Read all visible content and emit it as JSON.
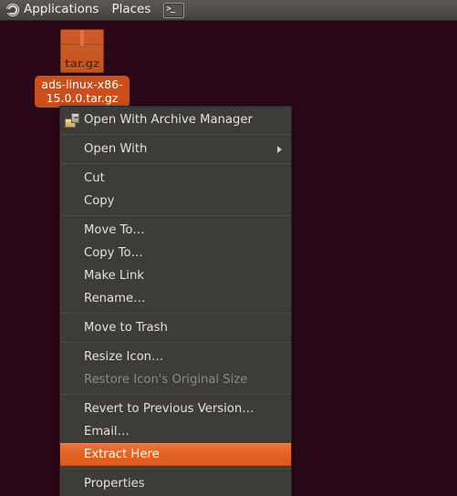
{
  "panel": {
    "applications_label": "Applications",
    "places_label": "Places",
    "applications_icon": "ubuntu-circle-icon",
    "terminal_icon": "terminal-icon",
    "terminal_glyph": ">_"
  },
  "desktop": {
    "background_color": "#2b0818",
    "file": {
      "name": "ads-linux-x86-15.0.0.tar.gz",
      "icon_name": "archive-tar-gz-icon",
      "icon_extension_label": "tar.gz",
      "selected": true,
      "selection_color": "#c9501c"
    }
  },
  "context_menu": {
    "background_color": "#3e3c38",
    "highlight_color": "#e2601f",
    "groups": [
      {
        "items": [
          {
            "label": "Open With Archive Manager",
            "icon": "archive-manager-icon",
            "state": "normal",
            "submenu": false
          }
        ]
      },
      {
        "items": [
          {
            "label": "Open With",
            "icon": null,
            "state": "normal",
            "submenu": true
          }
        ]
      },
      {
        "items": [
          {
            "label": "Cut",
            "icon": null,
            "state": "normal",
            "submenu": false
          },
          {
            "label": "Copy",
            "icon": null,
            "state": "normal",
            "submenu": false
          }
        ]
      },
      {
        "items": [
          {
            "label": "Move To…",
            "icon": null,
            "state": "normal",
            "submenu": false
          },
          {
            "label": "Copy To…",
            "icon": null,
            "state": "normal",
            "submenu": false
          },
          {
            "label": "Make Link",
            "icon": null,
            "state": "normal",
            "submenu": false
          },
          {
            "label": "Rename…",
            "icon": null,
            "state": "normal",
            "submenu": false
          }
        ]
      },
      {
        "items": [
          {
            "label": "Move to Trash",
            "icon": null,
            "state": "normal",
            "submenu": false
          }
        ]
      },
      {
        "items": [
          {
            "label": "Resize Icon…",
            "icon": null,
            "state": "normal",
            "submenu": false
          },
          {
            "label": "Restore Icon's Original Size",
            "icon": null,
            "state": "disabled",
            "submenu": false
          }
        ]
      },
      {
        "items": [
          {
            "label": "Revert to Previous Version…",
            "icon": null,
            "state": "normal",
            "submenu": false
          },
          {
            "label": "Email…",
            "icon": null,
            "state": "normal",
            "submenu": false
          },
          {
            "label": "Extract Here",
            "icon": null,
            "state": "selected",
            "submenu": false
          }
        ]
      },
      {
        "items": [
          {
            "label": "Properties",
            "icon": null,
            "state": "normal",
            "submenu": false
          }
        ]
      }
    ]
  }
}
